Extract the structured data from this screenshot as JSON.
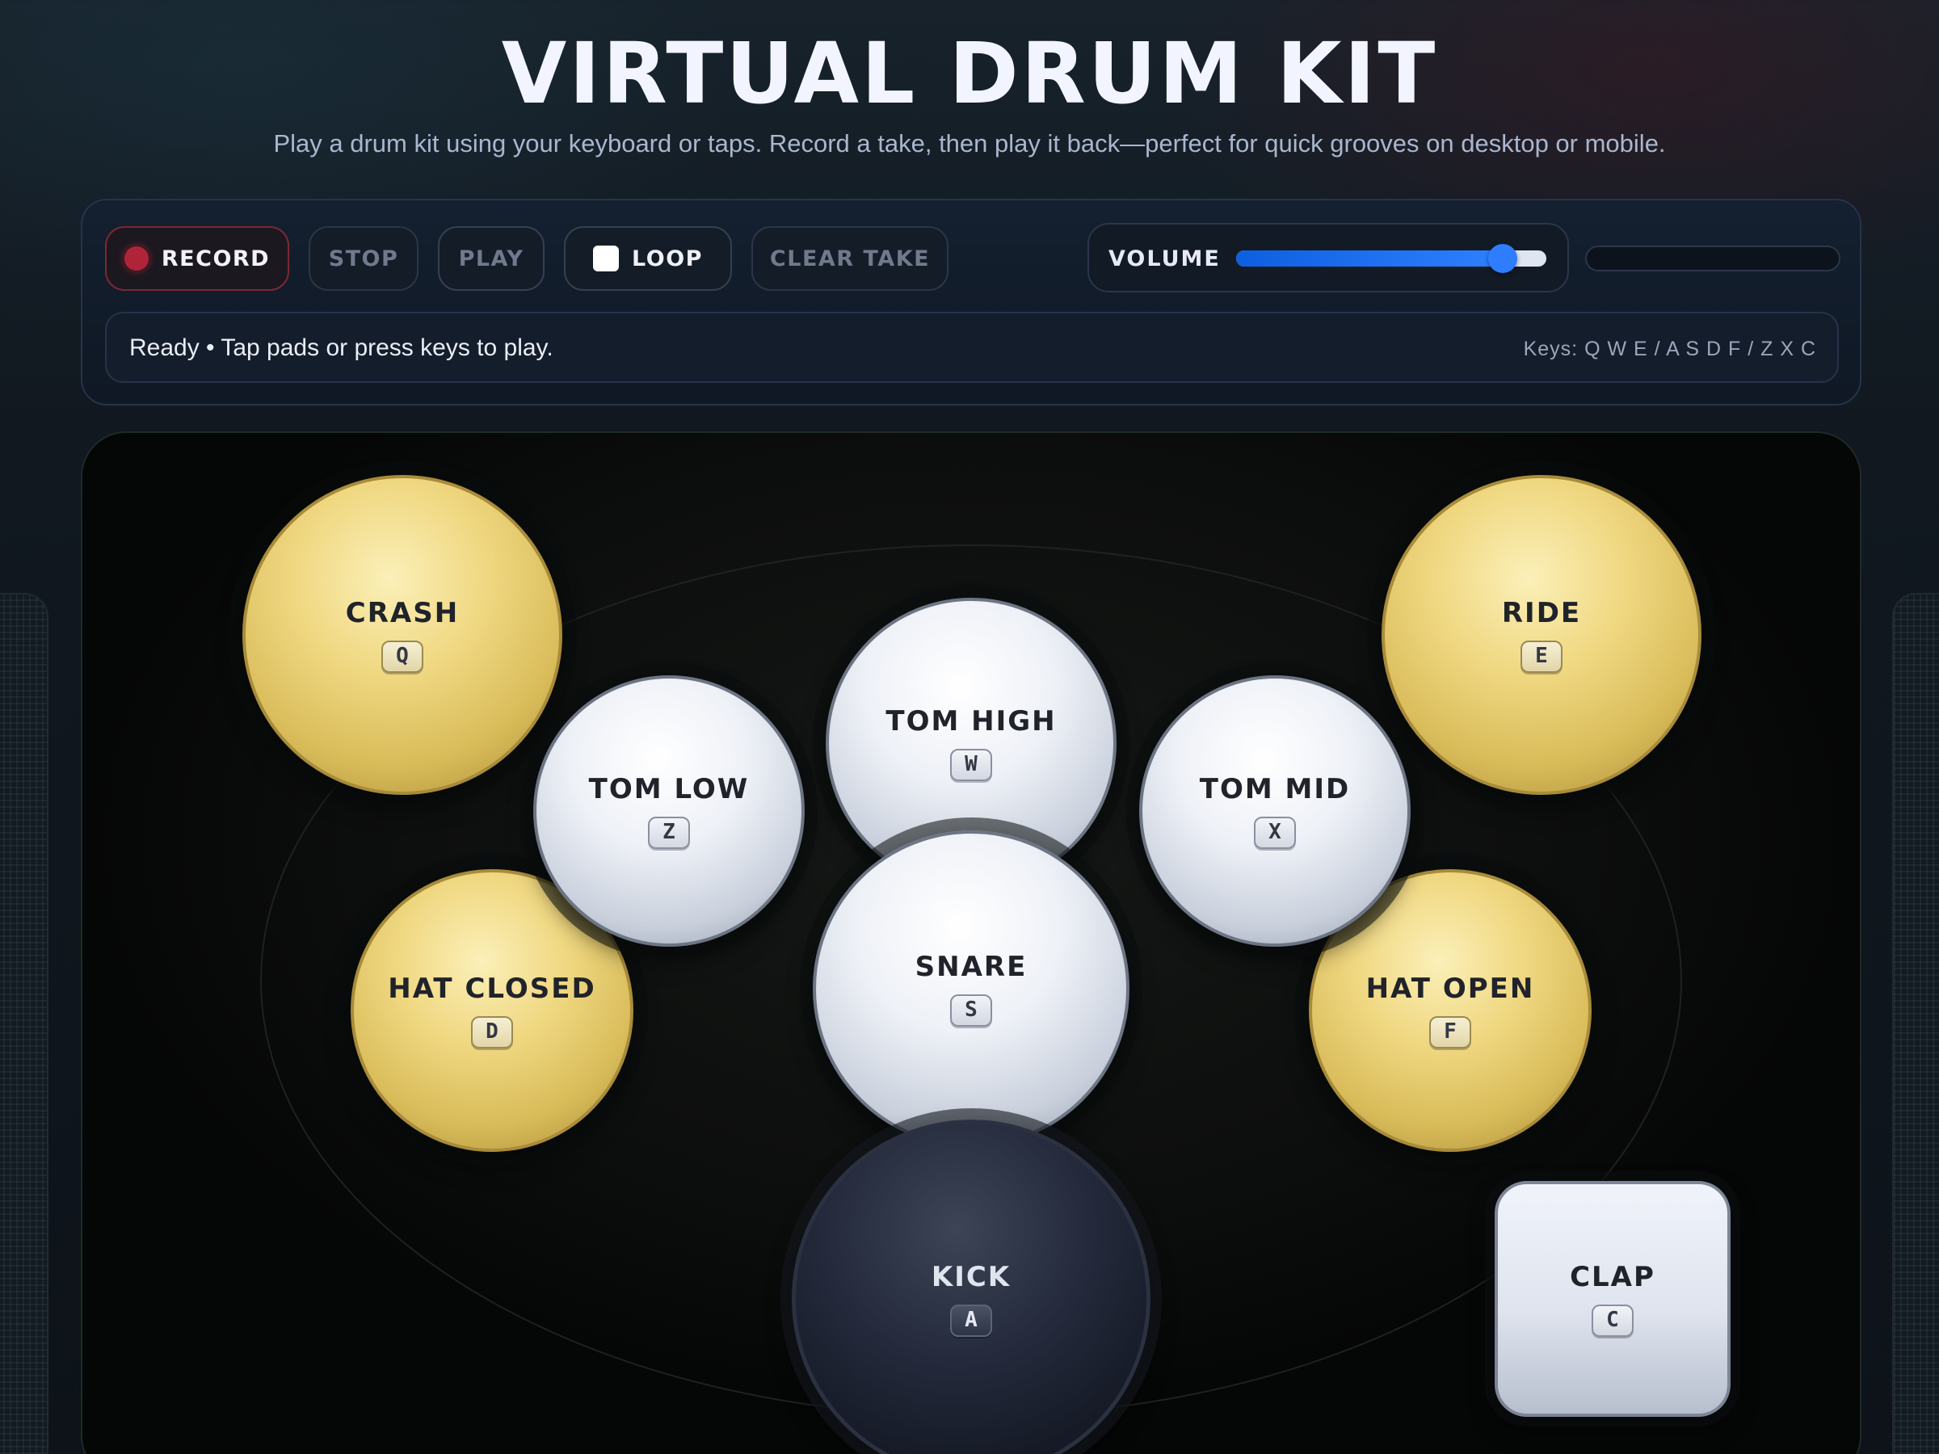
{
  "header": {
    "title": "VIRTUAL DRUM KIT",
    "subtitle": "Play a drum kit using your keyboard or taps. Record a take, then play it back—perfect for quick grooves on desktop or mobile."
  },
  "controls": {
    "record_label": "RECORD",
    "stop_label": "STOP",
    "play_label": "PLAY",
    "loop_label": "LOOP",
    "loop_checked": false,
    "clear_label": "CLEAR TAKE",
    "volume_label": "VOLUME",
    "volume_value": 0.86
  },
  "status": {
    "text": "Ready • Tap pads or press keys to play.",
    "keys_hint": "Keys: Q W E / A S D F / Z X C"
  },
  "pads": {
    "crash": {
      "label": "CRASH",
      "key": "Q"
    },
    "ride": {
      "label": "RIDE",
      "key": "E"
    },
    "tom_low": {
      "label": "TOM LOW",
      "key": "Z"
    },
    "tom_high": {
      "label": "TOM HIGH",
      "key": "W"
    },
    "tom_mid": {
      "label": "TOM MID",
      "key": "X"
    },
    "hat_closed": {
      "label": "HAT CLOSED",
      "key": "D"
    },
    "snare": {
      "label": "SNARE",
      "key": "S"
    },
    "hat_open": {
      "label": "HAT OPEN",
      "key": "F"
    },
    "kick": {
      "label": "KICK",
      "key": "A"
    },
    "clap": {
      "label": "CLAP",
      "key": "C"
    }
  },
  "colors": {
    "accent": "#2f7dff",
    "record": "#b0243a",
    "cymbal": "#e6cd6c",
    "drum_head": "#e9ecf3",
    "kick": "#1c2130"
  }
}
